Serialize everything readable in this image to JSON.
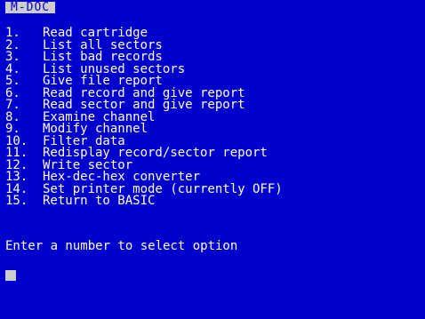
{
  "title": "M-DOC",
  "menu": {
    "items": [
      {
        "number": "1.",
        "label": "Read cartridge"
      },
      {
        "number": "2.",
        "label": "List all sectors"
      },
      {
        "number": "3.",
        "label": "List bad records"
      },
      {
        "number": "4.",
        "label": "List unused sectors"
      },
      {
        "number": "5.",
        "label": "Give file report"
      },
      {
        "number": "6.",
        "label": "Read record and give report"
      },
      {
        "number": "7.",
        "label": "Read sector and give report"
      },
      {
        "number": "8.",
        "label": "Examine channel"
      },
      {
        "number": "9.",
        "label": "Modify channel"
      },
      {
        "number": "10.",
        "label": "Filter data"
      },
      {
        "number": "11.",
        "label": "Redisplay record/sector report"
      },
      {
        "number": "12.",
        "label": "Write sector"
      },
      {
        "number": "13.",
        "label": "Hex-dec-hex converter"
      },
      {
        "number": "14.",
        "label": "Set printer mode (currently OFF)"
      },
      {
        "number": "15.",
        "label": "Return to BASIC"
      }
    ]
  },
  "prompt": "Enter a number to select option",
  "colors": {
    "background": "#0000cc",
    "text": "#ffffff",
    "title_bar": "#cccccc",
    "cursor": "#cccccc"
  }
}
